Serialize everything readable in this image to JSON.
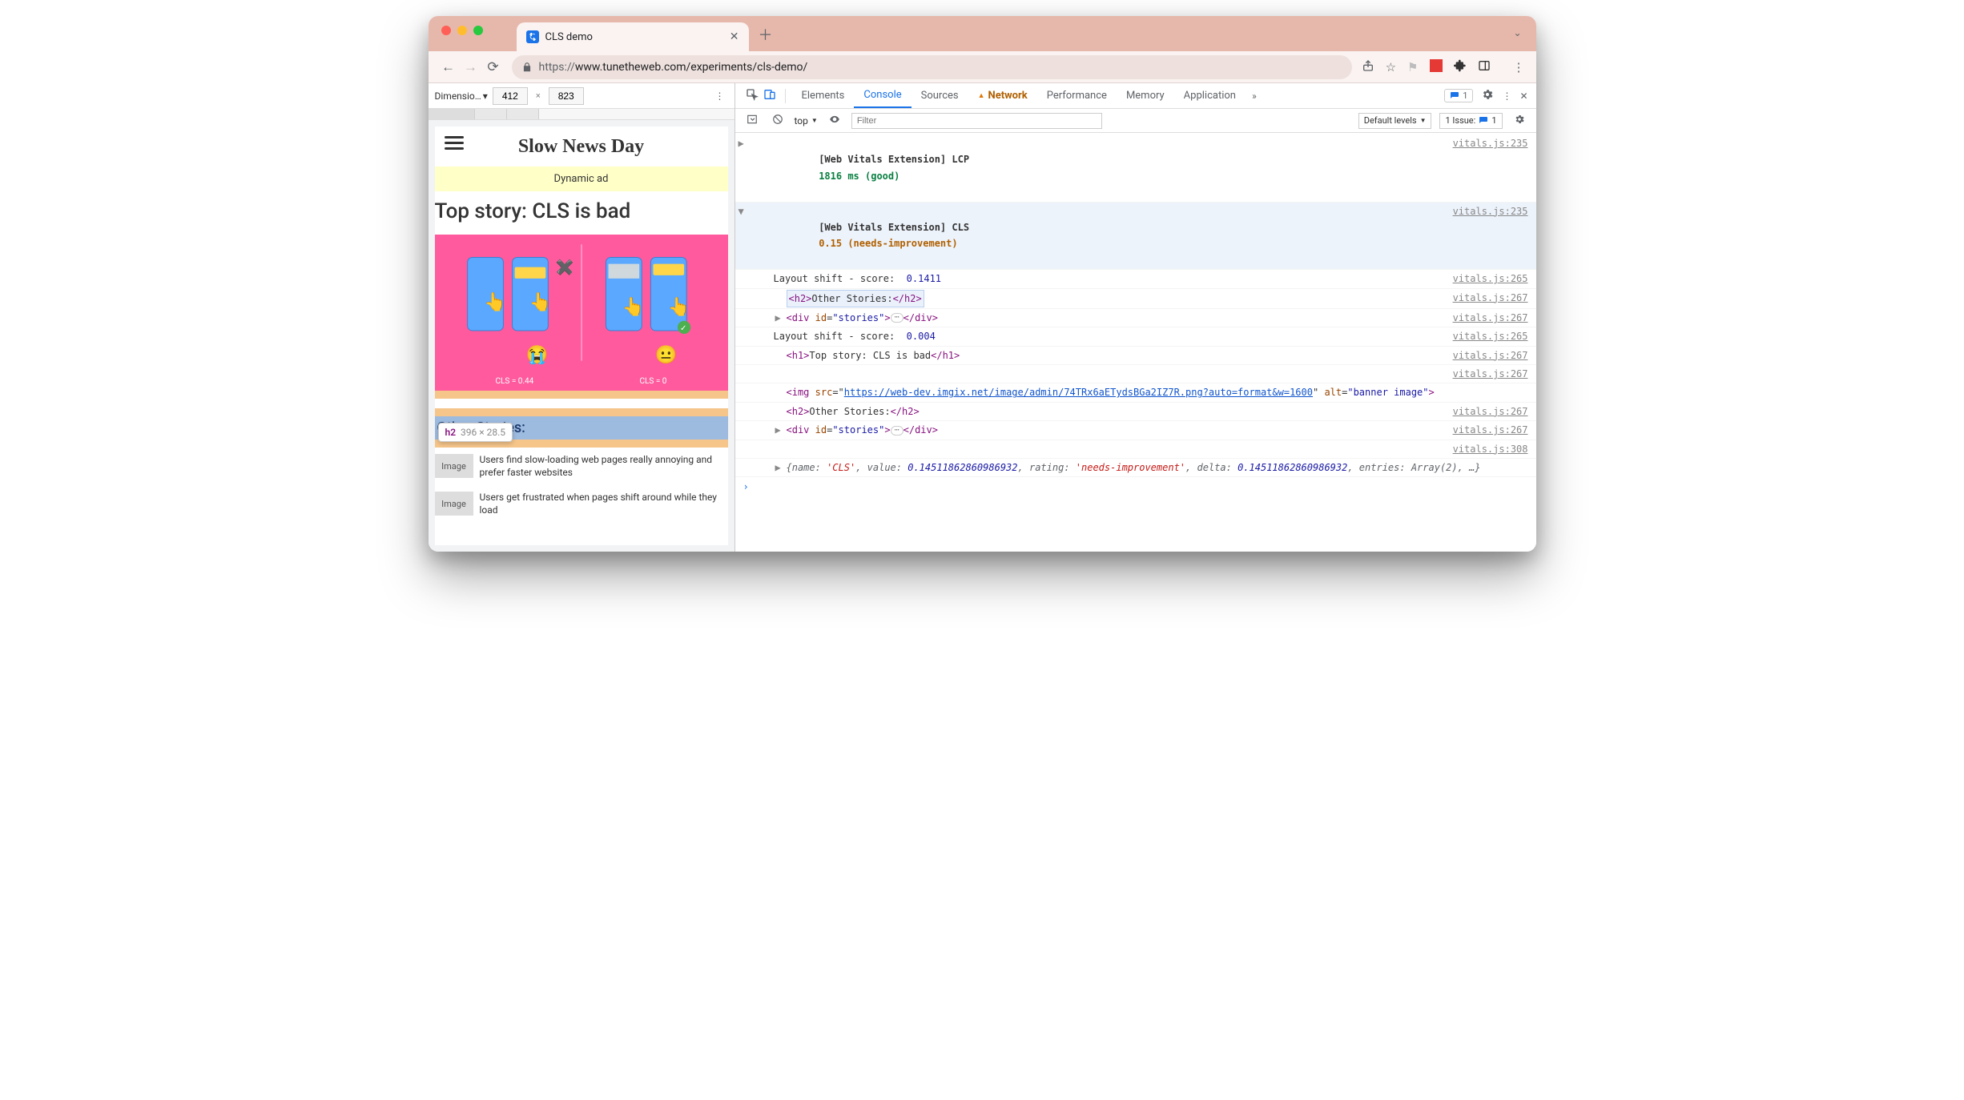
{
  "tab": {
    "title": "CLS demo"
  },
  "url": {
    "scheme": "https://",
    "rest": "www.tunetheweb.com/experiments/cls-demo/"
  },
  "dimensions": {
    "label": "Dimensio…",
    "w": "412",
    "h": "823",
    "sep": "×"
  },
  "page": {
    "site_title": "Slow News Day",
    "ad_text": "Dynamic ad",
    "top_story": "Top story: CLS is bad",
    "cls_bad": "CLS = 0.44",
    "cls_good": "CLS = 0",
    "h2": "Other Stories:",
    "inspect_tag": "h2",
    "inspect_dims": "396 × 28.5",
    "stories": [
      {
        "img": "Image",
        "txt": "Users find slow-loading web pages really annoying and prefer faster websites"
      },
      {
        "img": "Image",
        "txt": "Users get frustrated when pages shift around while they load"
      }
    ]
  },
  "devtools": {
    "tabs": [
      "Elements",
      "Console",
      "Sources",
      "Network",
      "Performance",
      "Memory",
      "Application"
    ],
    "active_tab": "Console",
    "issues_pill": "1",
    "context": "top",
    "filter_placeholder": "Filter",
    "levels": "Default levels",
    "issues_label": "1 Issue:",
    "issues_count": "1"
  },
  "console": {
    "lcp": {
      "prefix": "[Web Vitals Extension] LCP",
      "value": "1816 ms (good)",
      "src": "vitals.js:235"
    },
    "cls_header": {
      "prefix": "[Web Vitals Extension] CLS",
      "value": "0.15 (needs-improvement)",
      "src": "vitals.js:235"
    },
    "rows": [
      {
        "indent": 1,
        "html": "Layout shift - score:  <span class='num'>0.1411</span>",
        "src": "vitals.js:265"
      },
      {
        "indent": 2,
        "arrow": "",
        "boxed": true,
        "html": "<span class='tag'>&lt;h2&gt;</span>Other Stories:<span class='tag'>&lt;/h2&gt;</span>",
        "src": "vitals.js:267"
      },
      {
        "indent": 2,
        "arrow": "▶",
        "html": "<span class='tag'>&lt;div</span> <span class='attr'>id</span>=<span class='str'>\"stories\"</span><span class='tag'>&gt;</span><span class='ellipsis-chip'>⋯</span><span class='tag'>&lt;/div&gt;</span>",
        "src": "vitals.js:267"
      },
      {
        "indent": 1,
        "html": "Layout shift - score:  <span class='num'>0.004</span>",
        "src": "vitals.js:265"
      },
      {
        "indent": 2,
        "html": "<span class='tag'>&lt;h1&gt;</span>Top story: CLS is bad<span class='tag'>&lt;/h1&gt;</span>",
        "src": "vitals.js:267"
      },
      {
        "indent": 2,
        "html": "",
        "src": "vitals.js:267"
      },
      {
        "indent": 2,
        "wrap": true,
        "html": "<span class='tag'>&lt;img</span> <span class='attr'>src</span>=\"<span class='link'>https://web-dev.imgix.net/image/admin/74TRx6aETydsBGa2IZ7R.png?auto=format&amp;w=1600</span>\" <span class='attr'>alt</span>=<span class='str'>\"banner image\"</span><span class='tag'>&gt;</span>",
        "src": ""
      },
      {
        "indent": 2,
        "html": "<span class='tag'>&lt;h2&gt;</span>Other Stories:<span class='tag'>&lt;/h2&gt;</span>",
        "src": "vitals.js:267"
      },
      {
        "indent": 2,
        "arrow": "▶",
        "html": "<span class='tag'>&lt;div</span> <span class='attr'>id</span>=<span class='str'>\"stories\"</span><span class='tag'>&gt;</span><span class='ellipsis-chip'>⋯</span><span class='tag'>&lt;/div&gt;</span>",
        "src": "vitals.js:267"
      },
      {
        "indent": 1,
        "html": "",
        "src": "vitals.js:308"
      },
      {
        "indent": 2,
        "arrow": "▶",
        "obj": true,
        "html": "{name: <span class='q'>'CLS'</span>, value: <span class='n'>0.14511862860986932</span>, rating: <span class='q'>'needs-improvement'</span>, delta: <span class='n'>0.14511862860986932</span>, entries: Array(2), …}",
        "src": ""
      }
    ]
  }
}
